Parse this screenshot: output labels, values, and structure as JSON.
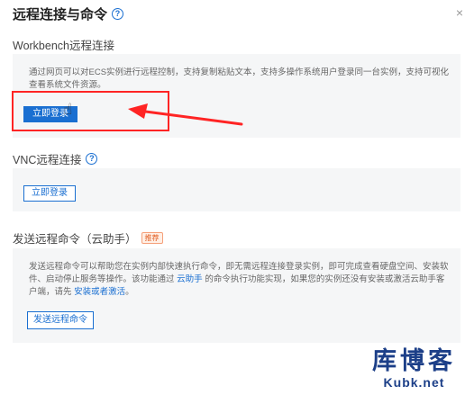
{
  "dialog": {
    "title": "远程连接与命令",
    "close_icon": "×"
  },
  "workbench": {
    "title": "Workbench远程连接",
    "description": "通过网页可以对ECS实例进行远程控制，支持复制粘贴文本，支持多操作系统用户登录同一台实例，支持可视化查看系统文件资源。",
    "button_label": "立即登录"
  },
  "vnc": {
    "title": "VNC远程连接",
    "button_label": "立即登录"
  },
  "cloud_assistant": {
    "title": "发送远程命令（云助手）",
    "badge": "推荐",
    "description_1": "发送远程命令可以帮助您在实例内部快速执行命令，即无需远程连接登录实例，即可完成查看硬盘空间、安装软件、启动停止服务等操作。该功能通过",
    "link_1": "云助手",
    "description_2": "的命令执行功能实现，如果您的实例还没有安装或激活云助手客户端，请先",
    "link_2": "安装或者激活",
    "description_3": "。",
    "button_label": "发送远程命令"
  },
  "watermark": {
    "chinese": "库博客",
    "english": "Kubk.net"
  },
  "colors": {
    "accent": "#1a6fd1",
    "annotation_red": "#ff2424",
    "panel_bg": "#f5f6f7"
  }
}
